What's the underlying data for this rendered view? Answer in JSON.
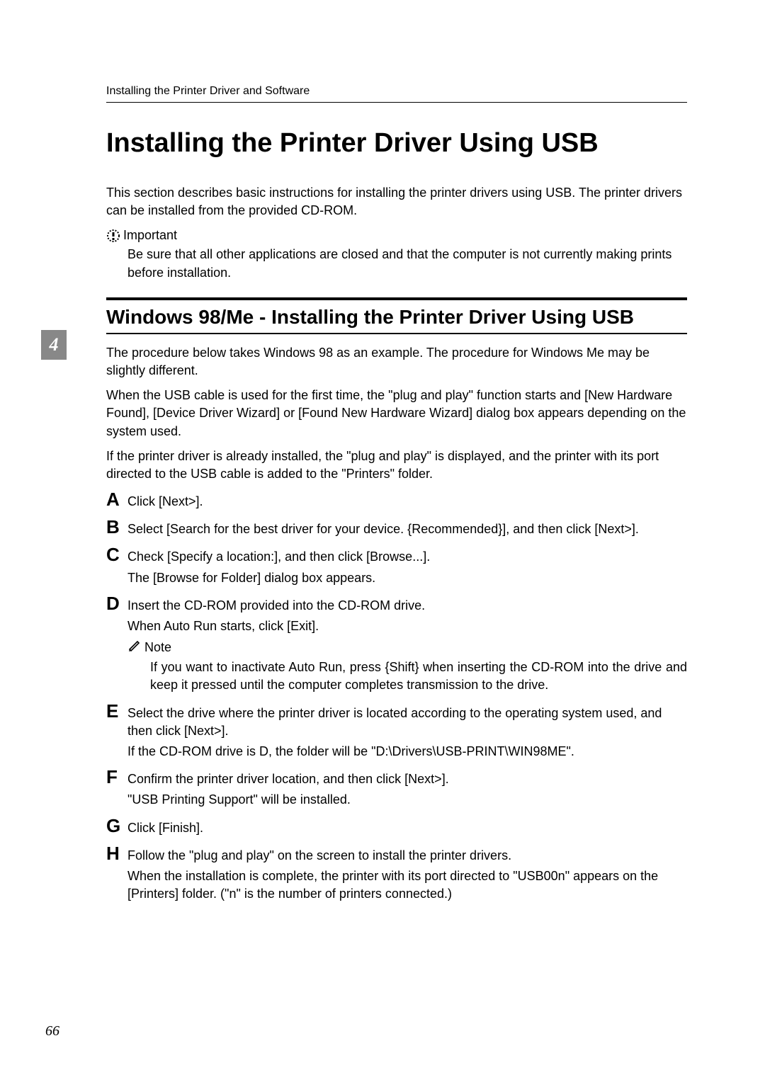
{
  "running_header": "Installing the Printer Driver and Software",
  "title": "Installing the Printer Driver Using USB",
  "intro": "This section describes basic instructions for installing the printer drivers using USB. The printer drivers can be installed from the provided CD-ROM.",
  "important_label": "Important",
  "important_body": "Be sure that all other applications are closed and that the computer is not currently making prints before installation.",
  "section_heading": "Windows 98/Me - Installing the Printer Driver Using USB",
  "para1": "The procedure below takes Windows 98 as an example. The procedure for Windows Me may be slightly different.",
  "para2": "When the USB cable is used for the first time, the \"plug and play\" function starts and [New Hardware Found], [Device Driver Wizard] or [Found New Hardware Wizard] dialog box appears depending on the system used.",
  "para3": "If the printer driver is already installed, the \"plug and play\" is displayed, and the printer with its port directed to the USB cable is added to the \"Printers\" folder.",
  "steps": {
    "A": {
      "label": "A",
      "text": "Click [Next>]."
    },
    "B": {
      "label": "B",
      "text": "Select [Search for the best driver for your device. {Recommended}], and then click [Next>]."
    },
    "C": {
      "label": "C",
      "text": "Check [Specify a location:], and then click [Browse...].",
      "sub": "The [Browse for Folder] dialog box appears."
    },
    "D": {
      "label": "D",
      "text": "Insert the CD-ROM provided into the CD-ROM drive.",
      "sub": "When Auto Run starts, click [Exit]."
    },
    "E": {
      "label": "E",
      "text": "Select the drive where the printer driver is located according to the operating system used, and then click [Next>].",
      "sub": "If the CD-ROM drive is D, the folder will be \"D:\\Drivers\\USB-PRINT\\WIN98ME\"."
    },
    "F": {
      "label": "F",
      "text": "Confirm the printer driver location, and then click [Next>].",
      "sub": "\"USB Printing Support\" will be installed."
    },
    "G": {
      "label": "G",
      "text": "Click [Finish]."
    },
    "H": {
      "label": "H",
      "text": "Follow the \"plug and play\" on the screen to install the printer drivers.",
      "sub": "When the installation is complete, the printer with its port directed to \"USB00n\" appears on the [Printers] folder. (\"n\" is the number of printers connected.)"
    }
  },
  "note_label": "Note",
  "note_body": "If you want to inactivate Auto Run, press {Shift} when inserting the CD-ROM into the drive and keep it pressed until the computer completes transmission to the drive.",
  "page_number": "66",
  "side_tab": "4"
}
